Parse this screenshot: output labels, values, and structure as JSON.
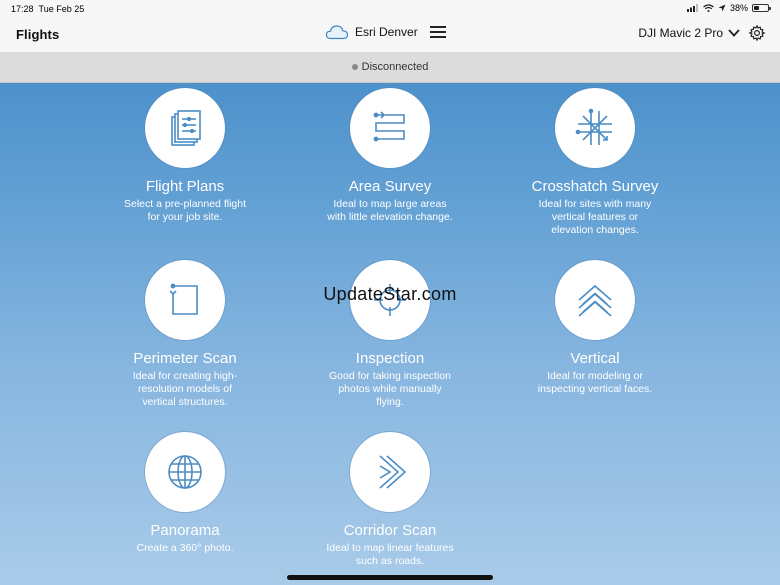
{
  "status": {
    "time": "17:28",
    "date": "Tue Feb 25",
    "battery": "38%",
    "battery_level": 0.38
  },
  "header": {
    "title": "Flights",
    "organization": "Esri Denver",
    "drone": "DJI Mavic 2 Pro"
  },
  "connection": {
    "status": "Disconnected"
  },
  "watermark": "UpdateStar.com",
  "icons": {
    "accent": "#4b8cc4",
    "drone_select": "chevron-down-icon",
    "settings": "gear-icon",
    "menu": "hamburger-icon",
    "org": "cloud-icon"
  },
  "flights": [
    {
      "title": "Flight Plans",
      "description": "Select a pre-planned flight\nfor your job site.",
      "icon": "documents-icon"
    },
    {
      "title": "Area Survey",
      "description": "Ideal to map large areas\nwith little elevation change.",
      "icon": "area-path-icon"
    },
    {
      "title": "Crosshatch Survey",
      "description": "Ideal for sites with many\nvertical features or\nelevation changes.",
      "icon": "crosshatch-icon"
    },
    {
      "title": "Perimeter Scan",
      "description": "Ideal for creating high-\nresolution models of\nvertical structures.",
      "icon": "perimeter-icon"
    },
    {
      "title": "Inspection",
      "description": "Good for taking inspection\nphotos while manually\nflying.",
      "icon": "target-icon"
    },
    {
      "title": "Vertical",
      "description": "Ideal for modeling or\ninspecting vertical faces.",
      "icon": "chevrons-up-icon"
    },
    {
      "title": "Panorama",
      "description": "Create a 360° photo.",
      "icon": "globe-icon"
    },
    {
      "title": "Corridor Scan",
      "description": "Ideal to map linear features\nsuch as roads.",
      "icon": "corridor-icon"
    }
  ]
}
